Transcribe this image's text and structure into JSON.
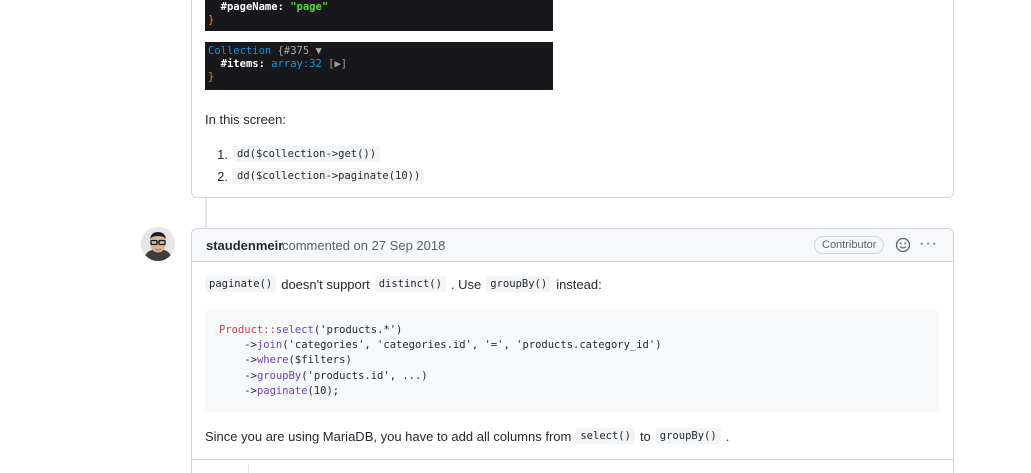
{
  "prev_comment": {
    "dump1": {
      "key": "#pageName",
      "sep": ": ",
      "value": "\"page\"",
      "close": "}"
    },
    "dump2": {
      "class": "Collection",
      "meta": "{#375 ▼",
      "key": "#items",
      "sep": ": ",
      "value": "array:32",
      "toggle": "[▶]",
      "close": "}"
    },
    "screen_text": "In this screen:",
    "steps": [
      {
        "num": "1.",
        "code": "dd($collection->get())"
      },
      {
        "num": "2.",
        "code": "dd($collection->paginate(10))"
      }
    ]
  },
  "comment": {
    "author": "staudenmeir",
    "meta": "commented on 27 Sep 2018",
    "badge": "Contributor",
    "emoji_icon": "smiley-icon",
    "more_icon": "kebab-horizontal-icon",
    "more_label": "···",
    "para1": {
      "code1": "paginate()",
      "text1": "doesn't support",
      "code2": "distinct()",
      "text2": ". Use",
      "code3": "groupBy()",
      "text3": "instead:"
    },
    "code_lines": [
      {
        "parts": [
          {
            "t": "Product",
            "c": "c-class"
          },
          {
            "t": "::",
            "c": "c-class"
          },
          {
            "t": "select",
            "c": "c-fn"
          },
          {
            "t": "('products.*')",
            "c": ""
          }
        ]
      },
      {
        "parts": [
          {
            "t": "    ->",
            "c": ""
          },
          {
            "t": "join",
            "c": "c-fn"
          },
          {
            "t": "('categories', 'categories.id', '=', 'products.category_id')",
            "c": ""
          }
        ]
      },
      {
        "parts": [
          {
            "t": "    ->",
            "c": ""
          },
          {
            "t": "where",
            "c": "c-fn"
          },
          {
            "t": "($filters)",
            "c": ""
          }
        ]
      },
      {
        "parts": [
          {
            "t": "    ->",
            "c": ""
          },
          {
            "t": "groupBy",
            "c": "c-fn"
          },
          {
            "t": "('products.id', ...)",
            "c": ""
          }
        ]
      },
      {
        "parts": [
          {
            "t": "    ->",
            "c": ""
          },
          {
            "t": "paginate",
            "c": "c-fn"
          },
          {
            "t": "(10);",
            "c": ""
          }
        ]
      }
    ],
    "para2": {
      "text1": "Since you are using MariaDB, you have to add all columns from",
      "code1": "select()",
      "text2": "to",
      "code2": "groupBy()",
      "text3": "."
    }
  }
}
